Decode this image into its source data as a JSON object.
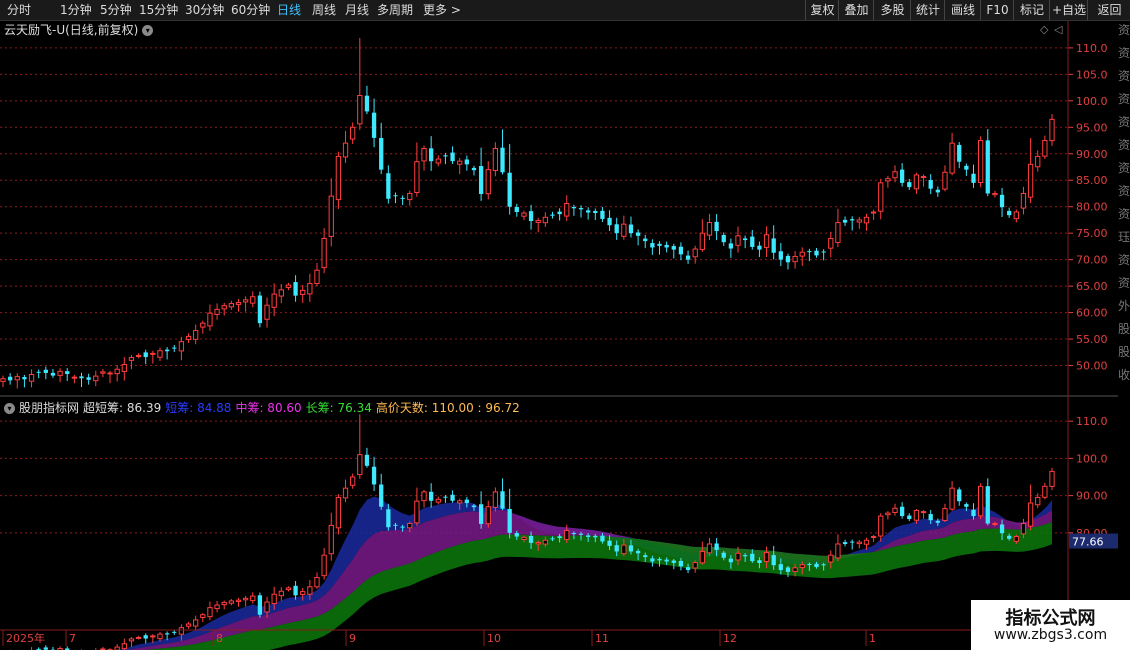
{
  "toolbar": {
    "left_items": [
      {
        "label": "分时",
        "active": false
      },
      {
        "label": "1分钟",
        "active": false
      },
      {
        "label": "5分钟",
        "active": false
      },
      {
        "label": "15分钟",
        "active": false
      },
      {
        "label": "30分钟",
        "active": false
      },
      {
        "label": "60分钟",
        "active": false
      },
      {
        "label": "日线",
        "active": true
      },
      {
        "label": "周线",
        "active": false
      },
      {
        "label": "月线",
        "active": false
      },
      {
        "label": "多周期",
        "active": false
      },
      {
        "label": "更多 >",
        "active": false
      }
    ],
    "right_items": [
      "复权",
      "叠加",
      "多股",
      "统计",
      "画线",
      "F10",
      "标记",
      "+自选",
      "返回"
    ]
  },
  "main_chart": {
    "title": "云天励飞-U(日线,前复权)",
    "y_ticks": [
      "110.0",
      "105.0",
      "100.0",
      "95.00",
      "90.00",
      "85.00",
      "80.00",
      "75.00",
      "70.00",
      "65.00",
      "60.00",
      "55.00",
      "50.00"
    ],
    "y_range": [
      45,
      113
    ]
  },
  "indicator": {
    "name": "股朋指标网",
    "items": [
      {
        "label": "超短筹: 86.39",
        "color": "#dddddd"
      },
      {
        "label": "短筹: 84.88",
        "color": "#2a3cff"
      },
      {
        "label": "中筹: 80.60",
        "color": "#ee33ee"
      },
      {
        "label": "长筹: 76.34",
        "color": "#33dd33"
      },
      {
        "label": "高价天数: 110.00 : 96.72",
        "color": "#ffbb55"
      }
    ],
    "y_ticks": [
      "110.0",
      "100.0",
      "90.00",
      "80.00"
    ],
    "current_value": "77.66"
  },
  "x_axis": {
    "labels": [
      "2025年",
      "7",
      "8",
      "9",
      "10",
      "11",
      "12",
      "1"
    ]
  },
  "right_side_glyphs": [
    "资",
    "资",
    "资",
    "资",
    "资",
    "资",
    "资",
    "资",
    "资",
    "珏",
    "资",
    "资",
    "外",
    "股",
    "股",
    "收"
  ],
  "watermark": {
    "line1": "指标公式网",
    "line2": "www.zbgs3.com"
  },
  "colors": {
    "up": "#ff3d3d",
    "down": "#3ee8ff",
    "grid": "#8a1c1c",
    "axis_text": "#e04040"
  },
  "series": {
    "closes": [
      47.5,
      47.2,
      47.9,
      47.4,
      48.3,
      48.8,
      48.6,
      48.1,
      48.9,
      48.4,
      47.8,
      47.6,
      47.3,
      48.0,
      48.8,
      48.6,
      49.3,
      50.2,
      51.5,
      51.9,
      51.6,
      52.3,
      52.8,
      52.7,
      53.2,
      54.5,
      55.5,
      56.6,
      58.0,
      59.9,
      60.6,
      61.3,
      61.7,
      61.9,
      62.4,
      63.0,
      58.0,
      61.4,
      63.5,
      64.3,
      65.2,
      63.2,
      64.2,
      65.5,
      68.0,
      74.0,
      82.0,
      89.5,
      92.0,
      95.0,
      101.0,
      98.0,
      93.0,
      87.0,
      81.5,
      82.0,
      81.6,
      82.5,
      88.5,
      91.0,
      88.6,
      89.0,
      89.5,
      88.6,
      88.6,
      88.0,
      86.9,
      82.4,
      87.0,
      91.0,
      86.5,
      80.0,
      79.0,
      78.8,
      77.3,
      77.4,
      78.0,
      78.3,
      78.6,
      80.6,
      79.7,
      79.5,
      78.9,
      78.8,
      77.7,
      76.5,
      75.0,
      76.7,
      75.0,
      74.5,
      73.5,
      72.3,
      72.6,
      72.3,
      71.9,
      71.0,
      70.0,
      72.0,
      75.0,
      77.0,
      75.4,
      73.3,
      72.1,
      74.5,
      73.7,
      72.4,
      71.9,
      74.7,
      71.3,
      70.0,
      69.5,
      70.6,
      71.4,
      71.5,
      70.8,
      71.5,
      74.0,
      77.0,
      77.0,
      77.4,
      77.5,
      78.0,
      79.0,
      84.5,
      85.3,
      86.6,
      84.5,
      83.7,
      86.0,
      85.7,
      83.4,
      82.7,
      86.5,
      92.0,
      88.5,
      87.0,
      84.5,
      92.5,
      82.5,
      82.5,
      79.9,
      78.4,
      79.0,
      82.5,
      88.0,
      89.5,
      92.5,
      96.5
    ]
  }
}
